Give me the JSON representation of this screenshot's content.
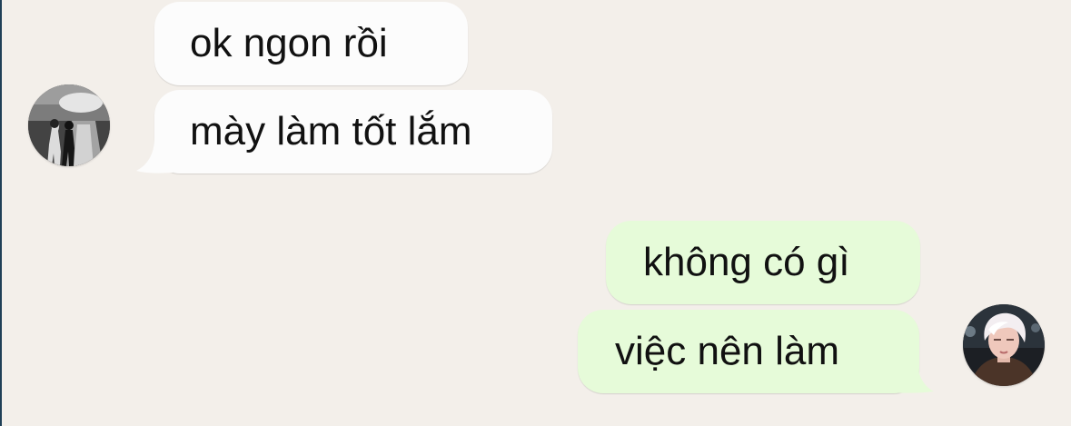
{
  "conversation": {
    "messages": [
      {
        "sender": "other",
        "text": "ok ngon rồi"
      },
      {
        "sender": "other",
        "text": "mày làm tốt lắm"
      },
      {
        "sender": "me",
        "text": "không có gì"
      },
      {
        "sender": "me",
        "text": "việc nên làm"
      }
    ]
  },
  "colors": {
    "background": "#f3efea",
    "incoming_bubble": "#fcfcfc",
    "outgoing_bubble": "#e6fbd9",
    "text": "#111111"
  }
}
